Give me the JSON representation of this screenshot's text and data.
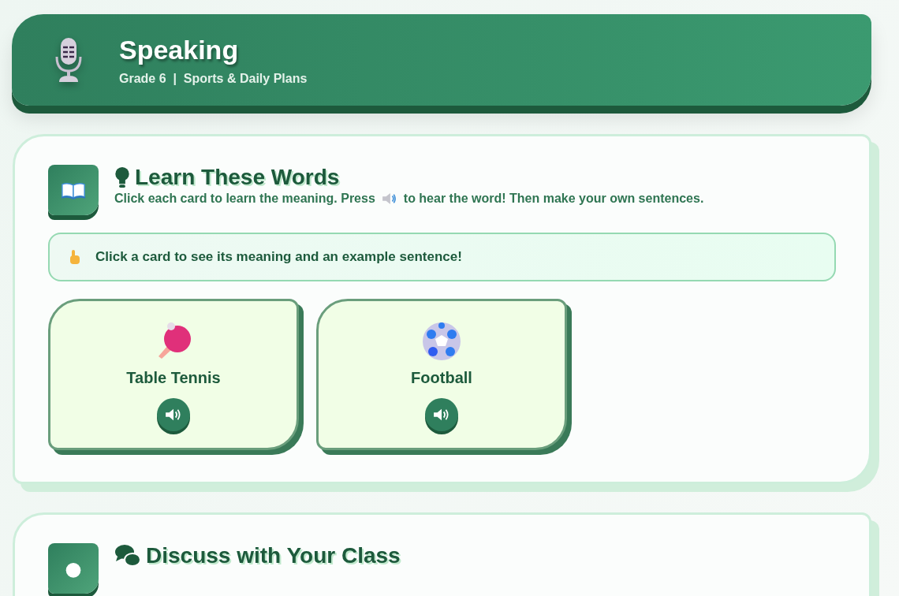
{
  "header": {
    "title": "Speaking",
    "subtitle": "Grade 6  |  Sports & Daily Plans"
  },
  "sections": [
    {
      "kind": "words",
      "title": "Learn These Words",
      "instruction": [
        "Click each card to learn the meaning. Press",
        "to hear the word! Then make your own sentences."
      ],
      "hint": "Click a card to see its meaning and an example sentence!",
      "cards": [
        {
          "kind": "paddle",
          "word": "Table Tennis"
        },
        {
          "kind": "ball",
          "word": "Football"
        }
      ]
    },
    {
      "kind": "discuss",
      "title": "Discuss with Your Class"
    }
  ]
}
